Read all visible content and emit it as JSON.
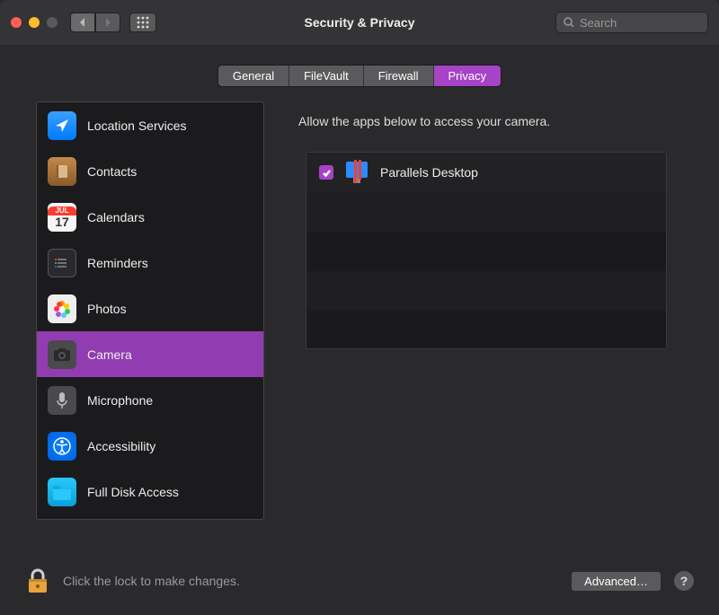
{
  "window": {
    "title": "Security & Privacy",
    "search_placeholder": "Search"
  },
  "tabs": [
    {
      "label": "General",
      "selected": false
    },
    {
      "label": "FileVault",
      "selected": false
    },
    {
      "label": "Firewall",
      "selected": false
    },
    {
      "label": "Privacy",
      "selected": true
    }
  ],
  "sidebar": {
    "items": [
      {
        "label": "Location Services",
        "icon": "location",
        "selected": false
      },
      {
        "label": "Contacts",
        "icon": "contacts",
        "selected": false
      },
      {
        "label": "Calendars",
        "icon": "calendar",
        "selected": false
      },
      {
        "label": "Reminders",
        "icon": "reminders",
        "selected": false
      },
      {
        "label": "Photos",
        "icon": "photos",
        "selected": false
      },
      {
        "label": "Camera",
        "icon": "camera",
        "selected": true
      },
      {
        "label": "Microphone",
        "icon": "microphone",
        "selected": false
      },
      {
        "label": "Accessibility",
        "icon": "access",
        "selected": false
      },
      {
        "label": "Full Disk Access",
        "icon": "disk",
        "selected": false
      }
    ],
    "calendar_icon": {
      "month": "JUL",
      "day": "17"
    }
  },
  "content": {
    "heading": "Allow the apps below to access your camera.",
    "apps": [
      {
        "name": "Parallels Desktop",
        "checked": true
      }
    ]
  },
  "footer": {
    "lock_message": "Click the lock to make changes.",
    "advanced_label": "Advanced…",
    "help_label": "?"
  }
}
